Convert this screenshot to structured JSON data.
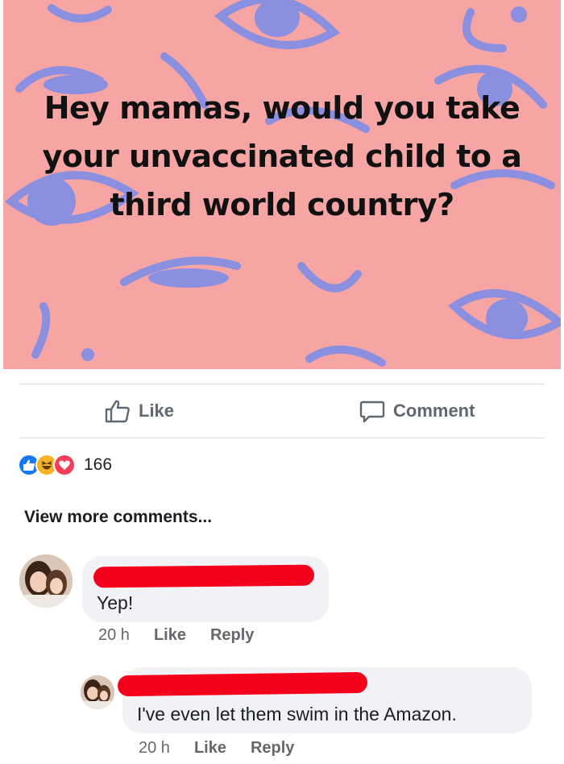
{
  "post": {
    "text": "Hey mamas, would you take your unvaccinated child to a third world country?",
    "background_color": "#f6a5a4",
    "doodle_color": "#8a8fe0"
  },
  "actions": {
    "like_label": "Like",
    "like_icon": "thumbs-up-outline-icon",
    "comment_label": "Comment",
    "comment_icon": "speech-bubble-outline-icon"
  },
  "reactions": {
    "icons": [
      "like-reaction-icon",
      "haha-reaction-icon",
      "love-reaction-icon"
    ],
    "count": "166"
  },
  "view_more": "View more comments...",
  "comments": [
    {
      "text": "Yep!",
      "time": "20 h",
      "like_label": "Like",
      "reply_label": "Reply"
    },
    {
      "text": "I've even let them swim in the Amazon.",
      "time": "20 h",
      "like_label": "Like",
      "reply_label": "Reply"
    }
  ],
  "colors": {
    "redaction": "#f4001c",
    "bubble": "#f0f2f5",
    "like_blue": "#1877f2",
    "love_red": "#f33e58",
    "haha_yellow": "#f7b125"
  }
}
